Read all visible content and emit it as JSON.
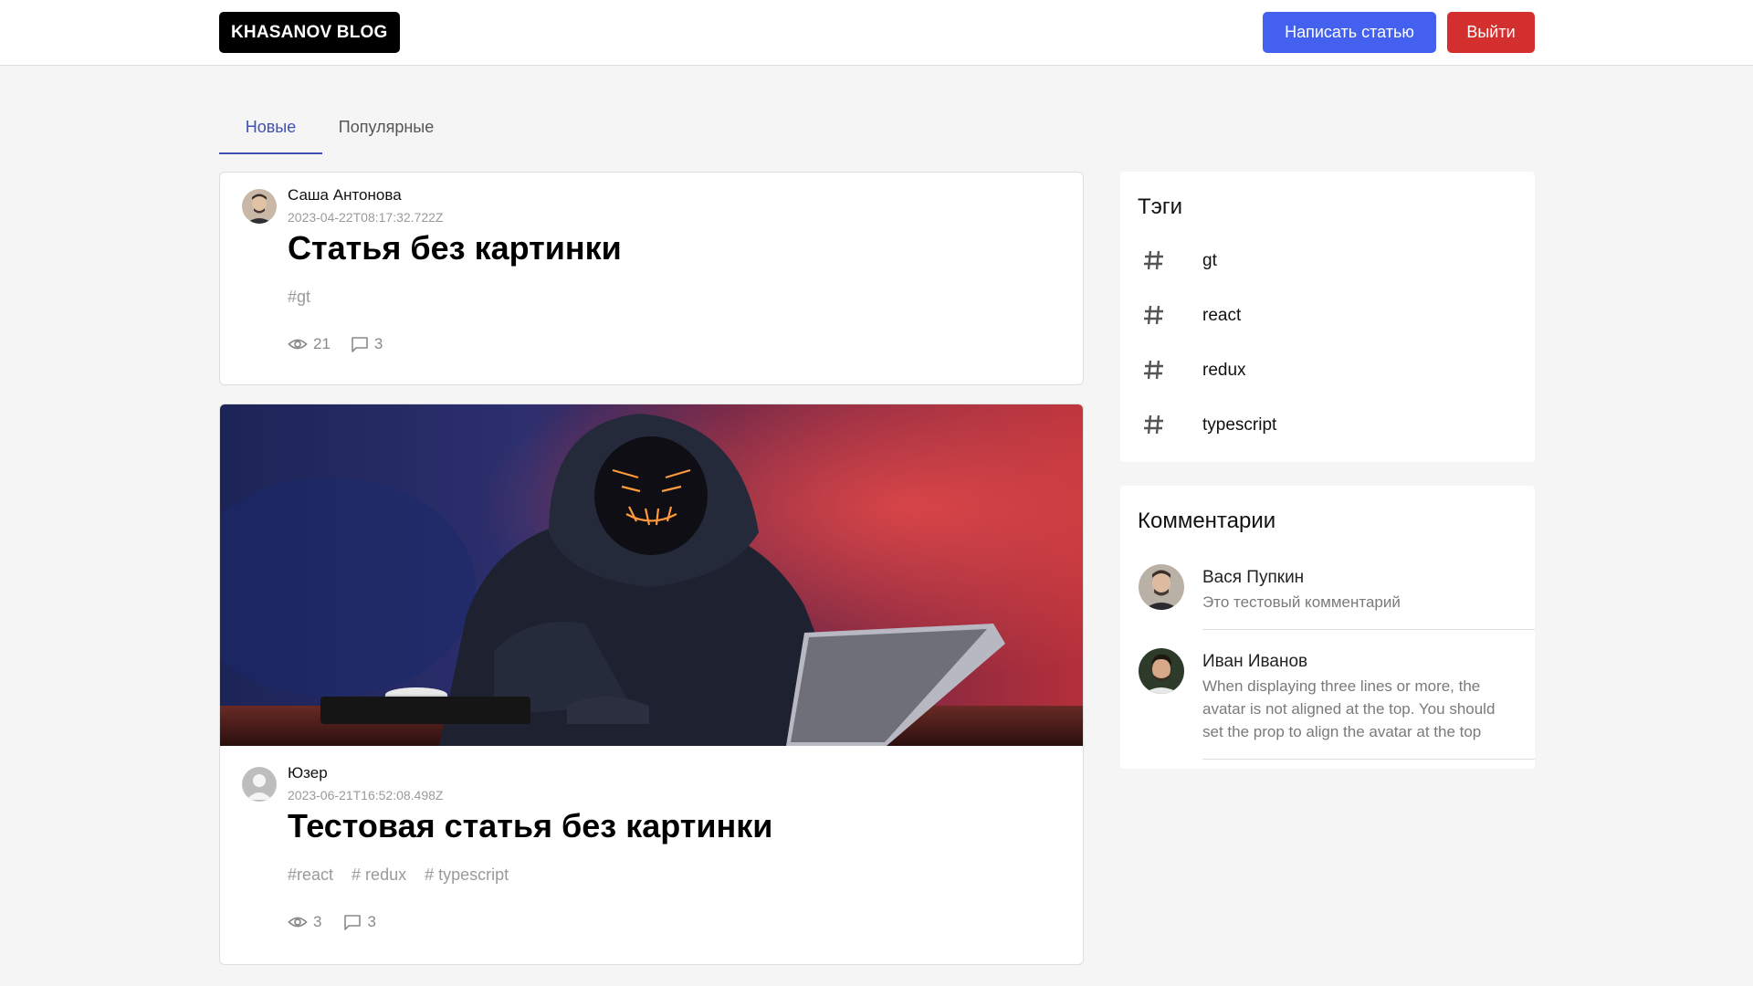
{
  "header": {
    "logo": "KHASANOV BLOG",
    "write_button": "Написать статью",
    "logout_button": "Выйти"
  },
  "tabs": [
    {
      "label": "Новые",
      "active": true
    },
    {
      "label": "Популярные",
      "active": false
    }
  ],
  "posts": [
    {
      "author": "Саша Антонова",
      "date": "2023-04-22T08:17:32.722Z",
      "title": "Статья без картинки",
      "tags": [
        "#gt"
      ],
      "views": "21",
      "comments": "3",
      "has_image": false
    },
    {
      "author": "Юзер",
      "date": "2023-06-21T16:52:08.498Z",
      "title": "Тестовая статья без картинки",
      "tags": [
        "#react",
        "# redux",
        "# typescript"
      ],
      "views": "3",
      "comments": "3",
      "has_image": true
    }
  ],
  "sidebar": {
    "tags_title": "Тэги",
    "tags": [
      "gt",
      "react",
      "redux",
      "typescript"
    ],
    "comments_title": "Комментарии",
    "comments": [
      {
        "name": "Вася Пупкин",
        "text": "Это тестовый комментарий"
      },
      {
        "name": "Иван Иванов",
        "text": "When displaying three lines or more, the avatar is not aligned at the top. You should set the prop to align the avatar at the top"
      }
    ]
  },
  "colors": {
    "primary": "#4361ee",
    "danger": "#d32f2f",
    "tab_active": "#3f51b5"
  }
}
